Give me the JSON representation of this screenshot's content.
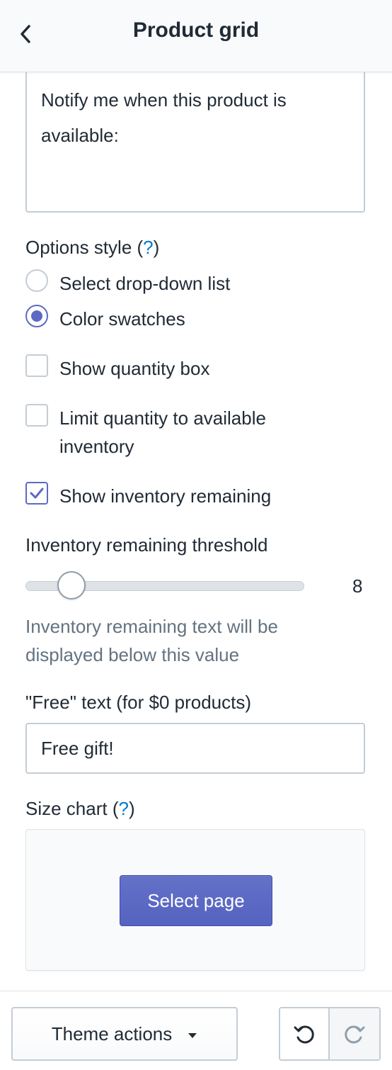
{
  "header": {
    "title": "Product grid",
    "back_icon": "chevron-left-icon"
  },
  "notify_textarea": {
    "value": "Notify me when this product is available:"
  },
  "options_style": {
    "label": "Options style (",
    "help": "?",
    "close": ")",
    "options": [
      {
        "label": "Select drop-down list",
        "checked": false
      },
      {
        "label": "Color swatches",
        "checked": true
      }
    ]
  },
  "checkboxes": {
    "show_quantity": {
      "label": "Show quantity box",
      "checked": false
    },
    "limit_quantity": {
      "label": "Limit quantity to available inventory",
      "checked": false
    },
    "show_inventory": {
      "label": "Show inventory remaining",
      "checked": true
    }
  },
  "threshold": {
    "label": "Inventory remaining threshold",
    "value": "8",
    "hint": "Inventory remaining text will be displayed below this value"
  },
  "free_text": {
    "label": "\"Free\" text (for $0 products)",
    "value": "Free gift!"
  },
  "size_chart": {
    "label": "Size chart (",
    "help": "?",
    "close": ")",
    "button": "Select page"
  },
  "footer": {
    "theme_actions": "Theme actions",
    "undo_icon": "undo-icon",
    "redo_icon": "redo-icon"
  },
  "colors": {
    "accent": "#5c6ac4",
    "help_link": "#007ace",
    "hint_text": "#637381",
    "border": "#c4cdd5"
  }
}
